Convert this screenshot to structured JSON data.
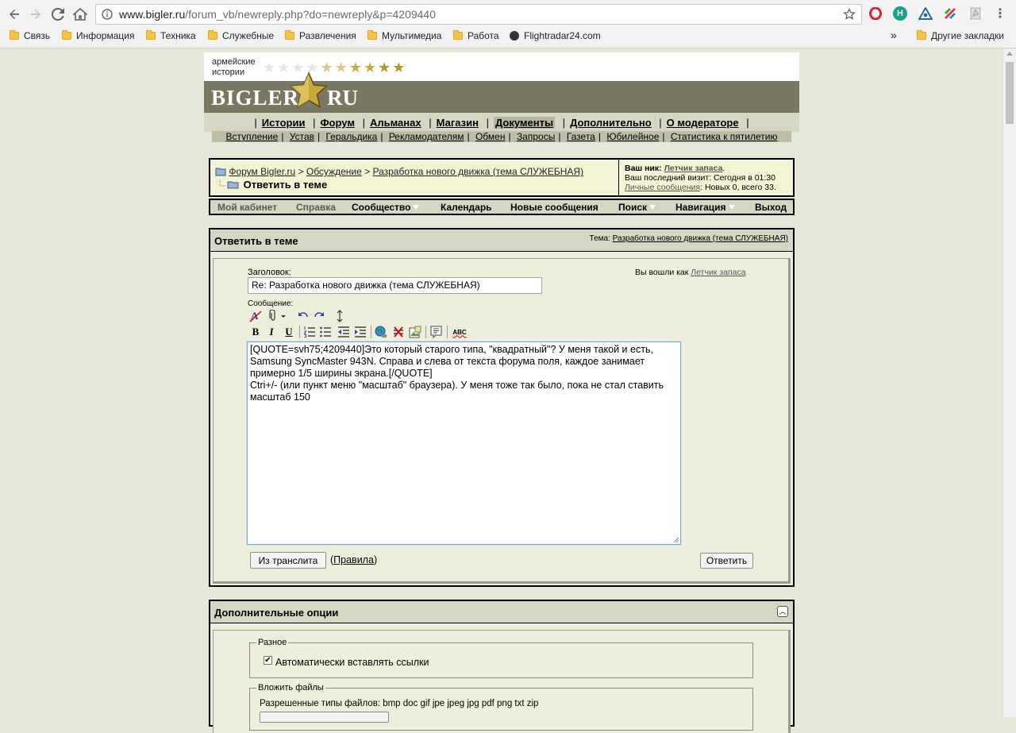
{
  "browser": {
    "url_host": "www.bigler.ru",
    "url_path": "/forum_vb/newreply.php?do=newreply&p=4209440",
    "bookmarks": [
      "Связь",
      "Информация",
      "Техника",
      "Служебные",
      "Развлечения",
      "Мультимедиа",
      "Работа",
      "Flightradar24.com"
    ],
    "overflow": "»",
    "other_bookmarks": "Другие закладки",
    "ext_h": "H"
  },
  "site": {
    "banner_text": "армейские истории",
    "logo_left": "BIGLER",
    "logo_right": "RU",
    "main_nav": [
      "Истории",
      "Форум",
      "Альманах",
      "Магазин",
      "Документы",
      "Дополнительно",
      "О модераторе"
    ],
    "sub_nav": [
      "Вступление",
      "Устав",
      "Геральдика",
      "Рекламодателям",
      "Обмен",
      "Запросы",
      "Газета",
      "Юбилейное",
      "Статистика к пятилетию"
    ]
  },
  "breadcrumb": {
    "forum": "Форум Bigler.ru",
    "section": "Обсуждение",
    "thread": "Разработка нового движка (тема СЛУЖЕБНАЯ)",
    "current": "Ответить в теме",
    "sep": ">"
  },
  "userinfo": {
    "nick_label": "Ваш ник:",
    "nick": "Летчик запаса",
    "last_visit": "Ваш последний визит: Сегодня в 01:30",
    "pm_link": "Личные сообщения",
    "pm_text": ": Новых 0, всего 33."
  },
  "usernav": {
    "cabinet": "Мой кабинет",
    "help": "Справка",
    "community": "Сообщество",
    "calendar": "Календарь",
    "new_posts": "Новые сообщения",
    "search": "Поиск",
    "navigation": "Навигация",
    "logout": "Выход"
  },
  "reply": {
    "title": "Ответить в теме",
    "topic_label": "Тема:",
    "topic": "Разработка нового движка (тема СЛУЖЕБНАЯ)",
    "logged_in_as": "Вы вошли как",
    "user": "Летчик запаса",
    "subject_label": "Заголовок:",
    "subject_value": "Re:  Разработка нового движка (тема СЛУЖЕБНАЯ)",
    "message_label": "Сообщение:",
    "message_text": "[QUOTE=svh75;4209440]Это который старого типа, \"квадратный\"? У меня такой и есть, Samsung SyncMaster 943N. Справа и слева от текста форума поля, каждое занимает примерно 1/5 ширины экрана.[/QUOTE]\nCtri+/- (или пункт меню \"масштаб\" браузера). У меня тоже так было, пока не стал ставить масштаб 150",
    "translit_button": "Из транслита",
    "rules_link": "Правила",
    "submit_button": "Ответить",
    "toolbar": {
      "bold": "B",
      "italic": "I",
      "underline": "U",
      "spell": "ABC"
    }
  },
  "options": {
    "title": "Дополнительные опции",
    "misc_legend": "Разное",
    "auto_links": "Автоматически вставлять ссылки",
    "attach_legend": "Вложить файлы",
    "allowed_types": "Разрешенные типы файлов: bmp doc gif jpe jpeg jpg pdf png txt zip"
  }
}
